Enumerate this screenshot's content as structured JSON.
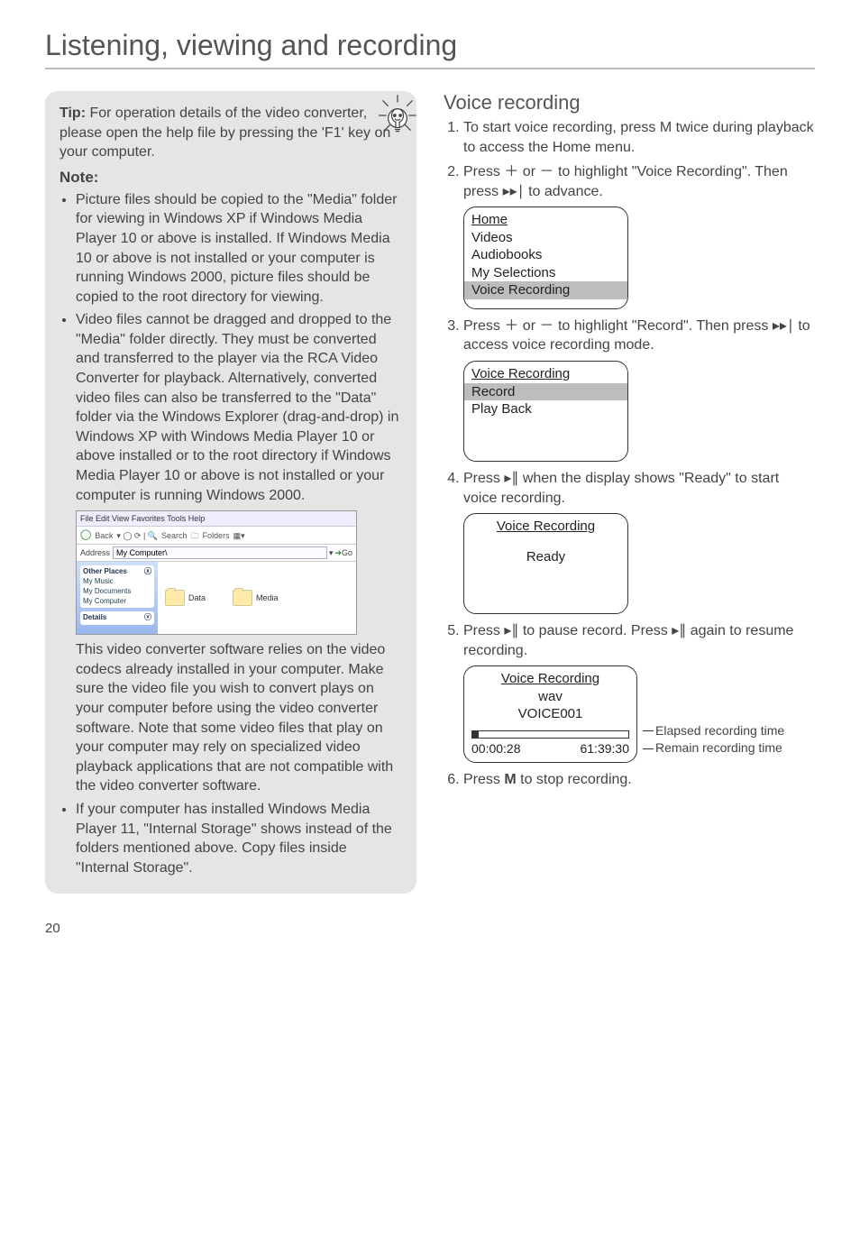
{
  "page": {
    "title": "Listening, viewing and recording",
    "number": "20"
  },
  "left": {
    "tip_label": "Tip:",
    "tip_text": " For operation details of the video converter, please open the help file by pressing the 'F1' key on your computer.",
    "note_heading": "Note:",
    "bullets": [
      "Picture files should be copied to the \"Media\" folder for viewing in Windows XP if Windows Media Player 10 or above is installed. If Windows Media 10 or above is not installed or your computer is running Windows 2000, picture files should be copied to the root directory for viewing.",
      "Video files cannot be dragged and dropped to the \"Media\" folder directly. They must be converted and transferred to the player via the RCA Video Converter for playback. Alternatively, converted video files can also be transferred  to the \"Data\" folder via the Windows Explorer (drag-and-drop) in Windows XP with Windows Media Player 10 or above installed or to the root directory if Windows Media Player 10 or above is not installed or your computer is running Windows 2000."
    ],
    "xp": {
      "menu": "File   Edit   View   Favorites   Tools   Help",
      "back": "Back",
      "search": "Search",
      "folders": "Folders",
      "address_label": "Address",
      "address_value": "My Computer\\",
      "go": "Go",
      "other_places": "Other Places",
      "places": [
        "My Music",
        "My Documents",
        "My Computer"
      ],
      "details": "Details",
      "folder_data": "Data",
      "folder_media": "Media"
    },
    "after_screenshot": "This video converter software relies on the video codecs already installed in your computer.  Make sure the video file you wish to convert plays on your computer before using the video converter software. Note that some video files that play on your computer may rely on specialized video playback applications that are not compatible with the video converter software.",
    "bullet3": "If your computer has installed Windows Media Player 11, \"Internal Storage\" shows instead of the folders mentioned above. Copy files inside \"Internal Storage\"."
  },
  "right": {
    "section": "Voice recording",
    "step1": "To start voice recording, press M twice during playback to access the Home menu.",
    "step2_a": "Press ",
    "step2_b": " or ",
    "step2_c": " to highlight \"Voice Recording\". Then press ",
    "step2_d": " to advance.",
    "screen1": {
      "title": "Home",
      "items": [
        "Videos",
        "Audiobooks",
        "My Selections",
        "Voice Recording"
      ],
      "highlight_index": 3
    },
    "step3_a": "Press ",
    "step3_b": " or ",
    "step3_c": " to highlight \"Record\". Then press ",
    "step3_d": " to access voice recording mode.",
    "screen2": {
      "title": "Voice Recording",
      "items": [
        "Record",
        "Play Back"
      ],
      "highlight_index": 0
    },
    "step4_a": "Press ",
    "step4_b": " when the display shows \"Ready\" to start voice recording.",
    "screen3": {
      "title": "Voice Recording",
      "center": "Ready"
    },
    "step5_a": "Press ",
    "step5_b": " to pause record. Press ",
    "step5_c": " again to resume recording.",
    "screen4": {
      "title": "Voice Recording",
      "line1": "wav",
      "line2": "VOICE001",
      "elapsed": "00:00:28",
      "remain": "61:39:30"
    },
    "annot": {
      "elapsed": "Elapsed recording time",
      "remain": "Remain recording time"
    },
    "step6_a": "Press ",
    "step6_m": "M",
    "step6_b": " to stop recording."
  },
  "glyphs": {
    "plus": "＋",
    "minus": "－",
    "next": "▸▸∣",
    "playpause": "▸∥"
  }
}
